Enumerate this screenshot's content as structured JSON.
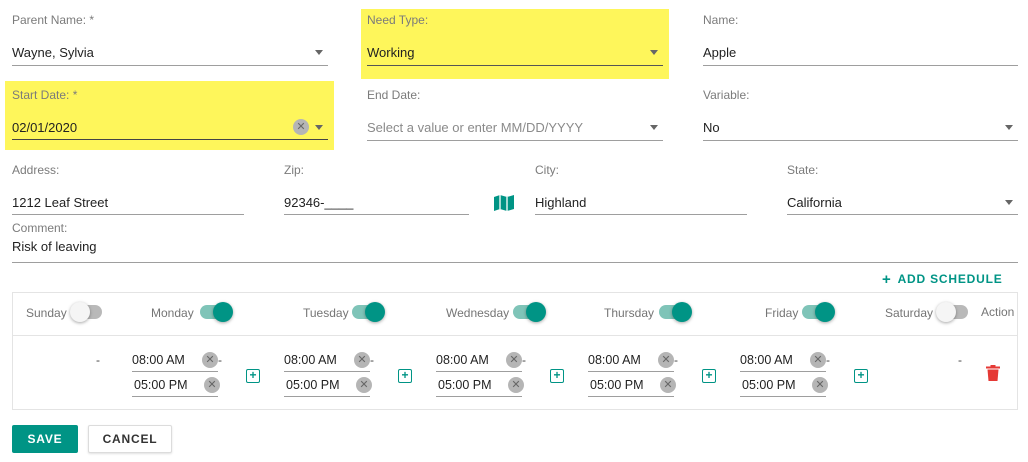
{
  "form": {
    "parent_name": {
      "label": "Parent Name: *",
      "value": "Wayne, Sylvia"
    },
    "need_type": {
      "label": "Need Type:",
      "value": "Working"
    },
    "name": {
      "label": "Name:",
      "value": "Apple"
    },
    "start_date": {
      "label": "Start Date: *",
      "value": "02/01/2020"
    },
    "end_date": {
      "label": "End Date:",
      "placeholder": "Select a value or enter MM/DD/YYYY"
    },
    "variable": {
      "label": "Variable:",
      "value": "No"
    },
    "address": {
      "label": "Address:",
      "value": "1212 Leaf Street"
    },
    "zip": {
      "label": "Zip:",
      "value": "92346-____"
    },
    "city": {
      "label": "City:",
      "value": "Highland"
    },
    "state": {
      "label": "State:",
      "value": "California"
    },
    "comment": {
      "label": "Comment:",
      "value": "Risk of leaving"
    }
  },
  "add_schedule_label": "ADD SCHEDULE",
  "schedule": {
    "days": [
      {
        "label": "Sunday",
        "enabled": false
      },
      {
        "label": "Monday",
        "enabled": true
      },
      {
        "label": "Tuesday",
        "enabled": true
      },
      {
        "label": "Wednesday",
        "enabled": true
      },
      {
        "label": "Thursday",
        "enabled": true
      },
      {
        "label": "Friday",
        "enabled": true
      },
      {
        "label": "Saturday",
        "enabled": false
      }
    ],
    "action_header": "Action",
    "empty_dash": "-",
    "slots": [
      {
        "start": "08:00 AM",
        "end": "05:00 PM",
        "sep": "-"
      },
      {
        "start": "08:00 AM",
        "end": "05:00 PM",
        "sep": "-"
      },
      {
        "start": "08:00 AM",
        "end": "05:00 PM",
        "sep": "-"
      },
      {
        "start": "08:00 AM",
        "end": "05:00 PM",
        "sep": "-"
      },
      {
        "start": "08:00 AM",
        "end": "05:00 PM",
        "sep": "-"
      }
    ]
  },
  "buttons": {
    "save": "SAVE",
    "cancel": "CANCEL"
  },
  "colors": {
    "accent": "#009485",
    "highlight": "#fef65b",
    "delete": "#e53935"
  }
}
